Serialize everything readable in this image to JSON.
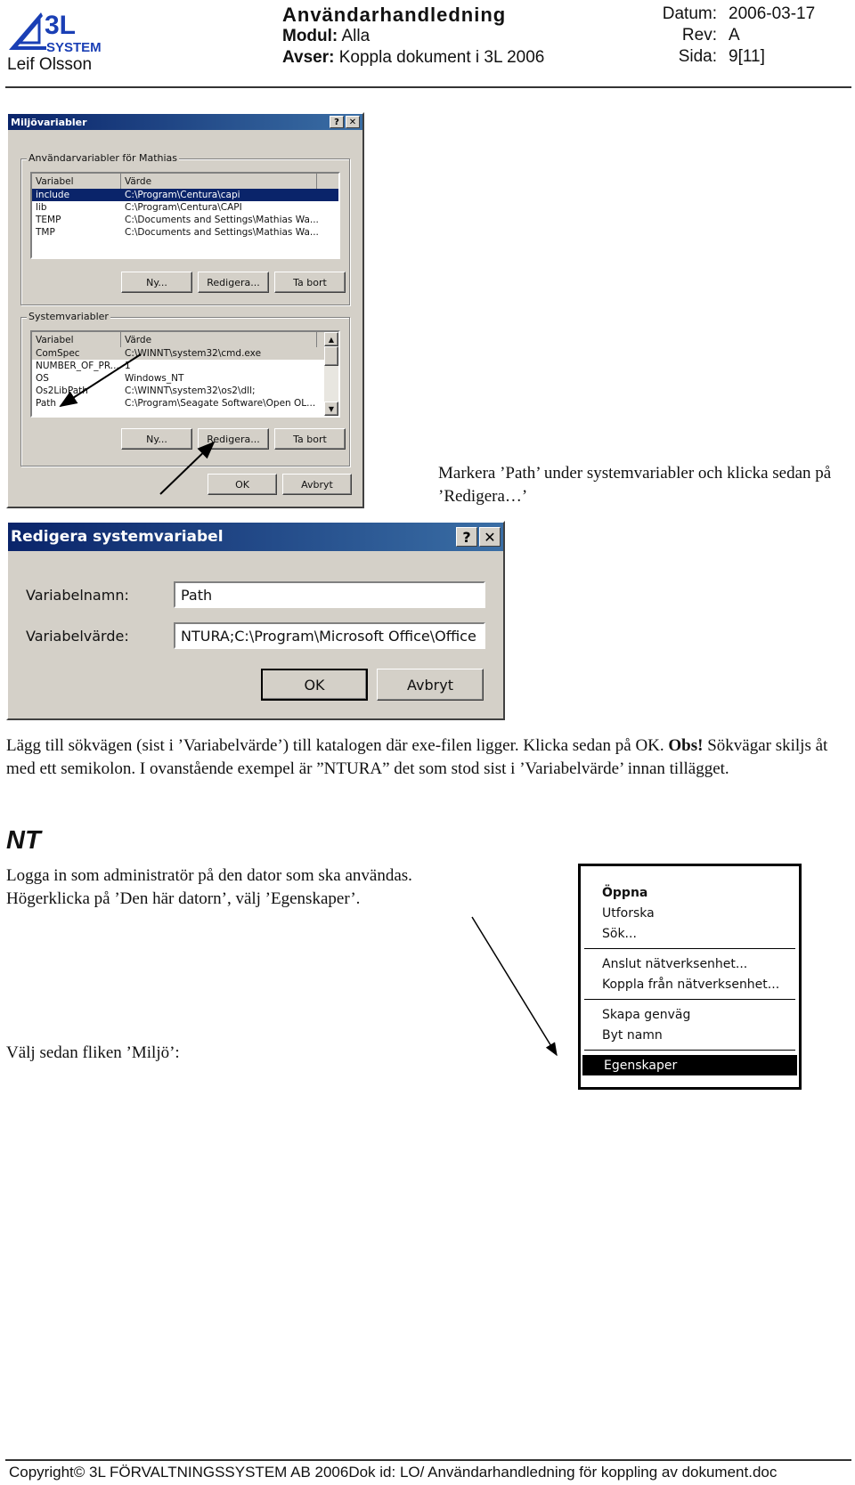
{
  "header": {
    "logo_text": "3L SYSTEM",
    "author": "Leif Olsson",
    "title": "Användarhandledning",
    "modul_label": "Modul:",
    "modul_value": "Alla",
    "avser_label": "Avser:",
    "avser_value": "Koppla dokument i 3L 2006",
    "datum_label": "Datum:",
    "datum_value": "2006-03-17",
    "rev_label": "Rev:",
    "rev_value": "A",
    "sida_label": "Sida:",
    "sida_value": "9[11]"
  },
  "env_dialog": {
    "title": "Miljövariabler",
    "user_group": "Användarvariabler för Mathias",
    "columns": [
      "Variabel",
      "Värde"
    ],
    "user_vars": [
      [
        "include",
        "C:\\Program\\Centura\\capi"
      ],
      [
        "lib",
        "C:\\Program\\Centura\\CAPI"
      ],
      [
        "TEMP",
        "C:\\Documents and Settings\\Mathias Wa..."
      ],
      [
        "TMP",
        "C:\\Documents and Settings\\Mathias Wa..."
      ]
    ],
    "system_group": "Systemvariabler",
    "system_vars": [
      [
        "ComSpec",
        "C:\\WINNT\\system32\\cmd.exe"
      ],
      [
        "NUMBER_OF_PR...",
        "1"
      ],
      [
        "OS",
        "Windows_NT"
      ],
      [
        "Os2LibPath",
        "C:\\WINNT\\system32\\os2\\dll;"
      ],
      [
        "Path",
        "C:\\Program\\Seagate Software\\Open OL..."
      ]
    ],
    "new": "Ny...",
    "edit": "Redigera...",
    "delete": "Ta bort",
    "ok": "OK",
    "cancel": "Avbryt"
  },
  "caption1": "Markera ’Path’ under systemvariabler och klicka sedan på ’Redigera…’",
  "edit_dialog": {
    "title": "Redigera systemvariabel",
    "name_label": "Variabelnamn:",
    "name_value": "Path",
    "value_label": "Variabelvärde:",
    "value_value": "NTURA;C:\\Program\\Microsoft Office\\Office",
    "ok": "OK",
    "cancel": "Avbryt"
  },
  "para1_a": "Lägg till sökvägen (sist i ’Variabelvärde’) till katalogen där exe-filen ligger. Klicka sedan på OK. ",
  "para1_bold": "Obs!",
  "para1_b": " Sökvägar skiljs åt med ett semikolon. I ovanstående exempel är ”NTURA” det som stod sist i ’Variabelvärde’ innan tillägget.",
  "nt_heading": "NT",
  "nt_line1": "Logga in som administratör på den dator som ska användas.",
  "nt_line2": "Högerklicka på ’Den här datorn’, välj ’Egenskaper’.",
  "nt_line3": "Välj sedan fliken ’Miljö’:",
  "context_menu": {
    "items": [
      "Öppna",
      "Utforska",
      "Sök...",
      "Anslut nätverksenhet...",
      "Koppla från nätverksenhet...",
      "Skapa genväg",
      "Byt namn",
      "Egenskaper"
    ]
  },
  "footer": "Copyright© 3L FÖRVALTNINGSSYSTEM AB 2006Dok id: LO/ Användarhandledning för koppling av dokument.doc"
}
